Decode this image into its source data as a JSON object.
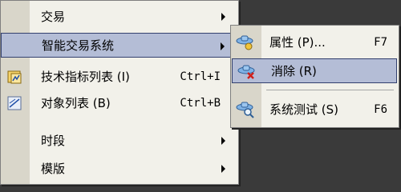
{
  "main_menu": {
    "items": [
      {
        "label": "交易",
        "shortcut": "",
        "submenu": true,
        "icon": ""
      },
      {
        "label": "智能交易系统",
        "shortcut": "",
        "submenu": true,
        "icon": "",
        "active": true
      },
      {
        "label": "技术指标列表 (I)",
        "shortcut": "Ctrl+I",
        "submenu": false,
        "icon": "indicator-list-icon"
      },
      {
        "label": "对象列表 (B)",
        "shortcut": "Ctrl+B",
        "submenu": false,
        "icon": "object-list-icon"
      },
      {
        "label": "时段",
        "shortcut": "",
        "submenu": true,
        "icon": ""
      },
      {
        "label": "模版",
        "shortcut": "",
        "submenu": true,
        "icon": ""
      }
    ]
  },
  "sub_menu": {
    "items": [
      {
        "label": "属性 (P)...",
        "shortcut": "F7",
        "icon": "expert-properties-icon"
      },
      {
        "label": "消除 (R)",
        "shortcut": "",
        "icon": "expert-remove-icon",
        "active": true
      },
      {
        "label": "系统测试 (S)",
        "shortcut": "F6",
        "icon": "strategy-tester-icon"
      }
    ]
  },
  "colors": {
    "menu_bg": "#f2f1ea",
    "gutter_bg": "#d9d6ca",
    "highlight_bg": "#b4bdd6",
    "highlight_border": "#32406e"
  }
}
